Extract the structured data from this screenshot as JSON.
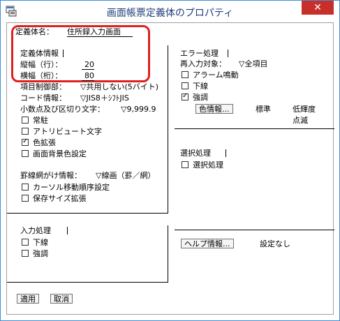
{
  "window": {
    "title": "画面帳票定義体のプロパティ",
    "close_label": "✕"
  },
  "definition": {
    "name_label": "定義体名：",
    "name_value": "住所録入力画面"
  },
  "def_info": {
    "header": "定義体情報",
    "height_label": "縦幅（行）：",
    "height_value": "20",
    "width_label": "横幅（桁）：",
    "width_value": "80"
  },
  "item_control": {
    "label": "項目制御部：",
    "value": "▽共用しない(5バイト)"
  },
  "code_info": {
    "label": "コード情報：",
    "value": "▽JIS8＋ｼﾌﾄJIS"
  },
  "decimal": {
    "label": "小数点及び区切り文字：",
    "value": "▽9,999.9"
  },
  "options": [
    {
      "label": "常駐",
      "checked": false
    },
    {
      "label": "アトリビュート文字",
      "checked": false
    },
    {
      "label": "色拡張",
      "checked": true
    },
    {
      "label": "画面背景色設定",
      "checked": false
    }
  ],
  "ruled_line": {
    "label": "罫線網がけ情報：",
    "value": "▽線画（罫／網）"
  },
  "options2": [
    {
      "label": "カーソル移動順序設定",
      "checked": false
    },
    {
      "label": "保存サイズ拡張",
      "checked": false
    }
  ],
  "input_processing": {
    "header": "入力処理",
    "options": [
      {
        "label": "下線",
        "checked": false
      },
      {
        "label": "強調",
        "checked": false
      }
    ]
  },
  "error_processing": {
    "header": "エラー処理",
    "reinput_label": "再入力対象：",
    "reinput_value": "▽全項目",
    "options": [
      {
        "label": "アラーム鳴動",
        "checked": false
      },
      {
        "label": "下線",
        "checked": false
      },
      {
        "label": "強調",
        "checked": true
      }
    ],
    "color_button": "色情報...",
    "color_value": "標準",
    "brightness_label": "低輝度",
    "blink_label": "点滅"
  },
  "selection_processing": {
    "header": "選択処理",
    "options": [
      {
        "label": "選択処理",
        "checked": false
      }
    ]
  },
  "help": {
    "button": "ヘルプ情報...",
    "value": "設定なし"
  },
  "footer": {
    "apply_label": "適用",
    "cancel_label": "取消"
  }
}
